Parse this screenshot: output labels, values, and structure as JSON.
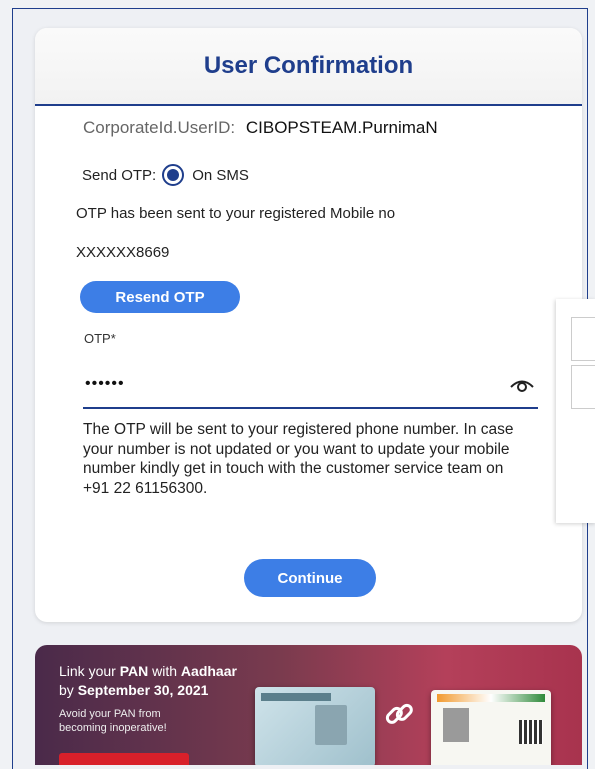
{
  "card": {
    "title": "User Confirmation",
    "user_id_label": "CorporateId.UserID:",
    "user_id_value": "CIBOPSTEAM.PurnimaN",
    "send_otp_label": "Send OTP:",
    "send_otp_option": "On SMS",
    "send_otp_selected": true,
    "sent_message": "OTP has been sent to your registered Mobile no",
    "masked_mobile": "XXXXXX8669",
    "resend_label": "Resend OTP",
    "otp_label": "OTP*",
    "otp_value": "••••••",
    "info_text": "The OTP will be sent to your registered phone number. In case your number is not updated or you want to update your mobile number kindly get in touch with the customer service team on +91 22 61156300.",
    "continue_label": "Continue"
  },
  "banner": {
    "line1_prefix": "Link your ",
    "line1_pan": "PAN",
    "line1_mid": " with ",
    "line1_aadhaar": "Aadhaar",
    "line2_prefix": "by ",
    "line2_date": "September 30, 2021",
    "line3": "Avoid your PAN from",
    "line4": "becoming inoperative!"
  },
  "colors": {
    "accent": "#1f3e8c",
    "button": "#3d7ee6"
  }
}
